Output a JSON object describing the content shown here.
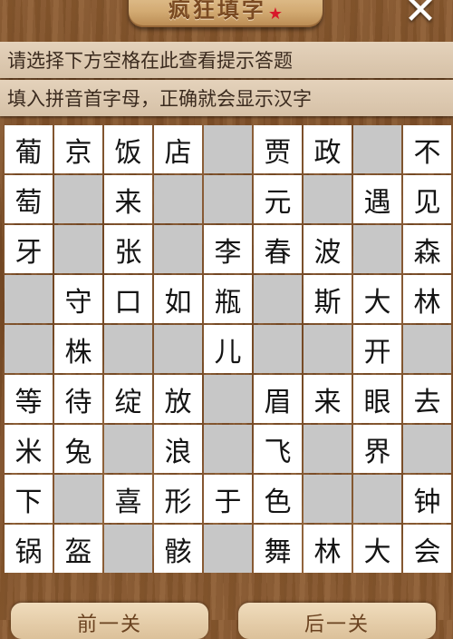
{
  "header": {
    "title": "疯狂填字",
    "close_label": "✕"
  },
  "hints": {
    "line1": "请选择下方空格在此查看提示答题",
    "line2": "填入拼音首字母，正确就会显示汉字"
  },
  "grid": [
    [
      "葡",
      "京",
      "饭",
      "店",
      "",
      "贾",
      "政",
      "",
      "不"
    ],
    [
      "萄",
      "",
      "来",
      "",
      "",
      "元",
      "",
      "遇",
      "见"
    ],
    [
      "牙",
      "",
      "张",
      "",
      "李",
      "春",
      "波",
      "",
      "森"
    ],
    [
      "",
      "守",
      "口",
      "如",
      "瓶",
      "",
      "斯",
      "大",
      "林"
    ],
    [
      "",
      "株",
      "",
      "",
      "儿",
      "",
      "",
      "开",
      ""
    ],
    [
      "等",
      "待",
      "绽",
      "放",
      "",
      "眉",
      "来",
      "眼",
      "去"
    ],
    [
      "米",
      "兔",
      "",
      "浪",
      "",
      "飞",
      "",
      "界",
      ""
    ],
    [
      "下",
      "",
      "喜",
      "形",
      "于",
      "色",
      "",
      "",
      "钟"
    ],
    [
      "锅",
      "盔",
      "",
      "骸",
      "",
      "舞",
      "林",
      "大",
      "会"
    ]
  ],
  "buttons": {
    "prev": "前一关",
    "next": "后一关"
  },
  "colors": {
    "blank_cell": "#c7c7c7",
    "filled_cell": "#ffffff",
    "hint_bar": "#dccab3"
  }
}
